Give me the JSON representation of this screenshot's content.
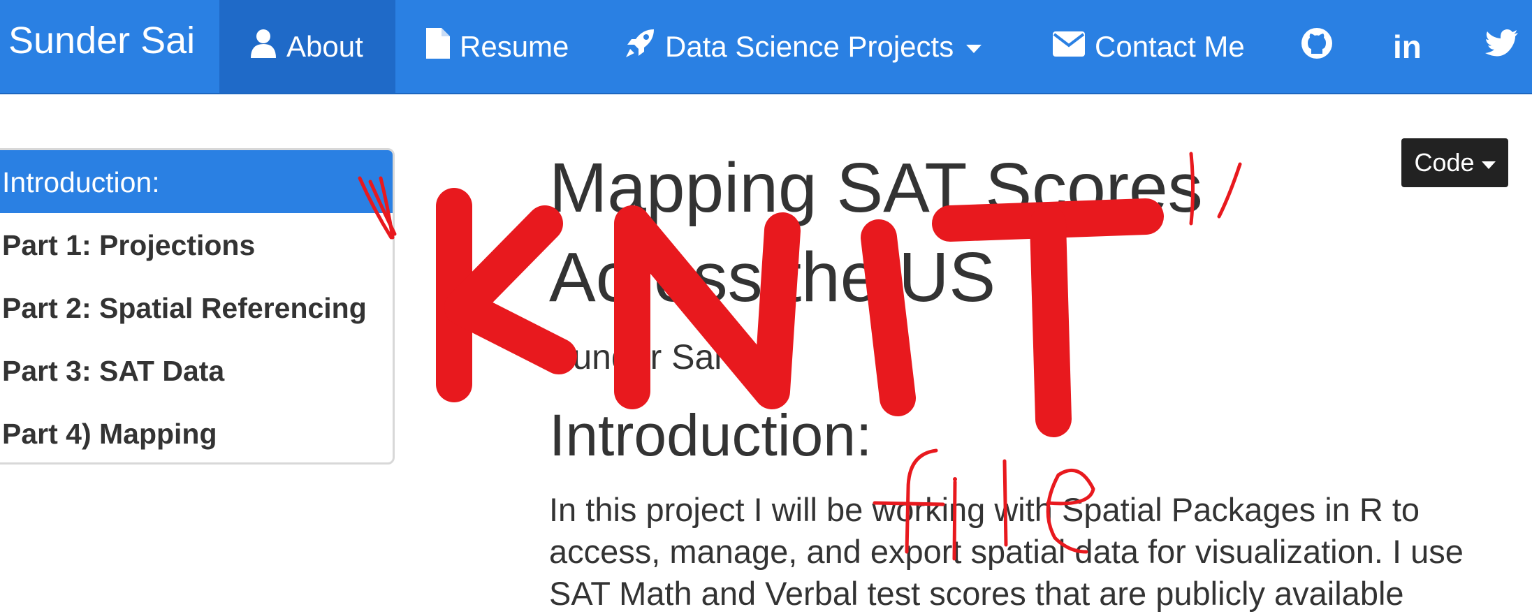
{
  "navbar": {
    "brand": "Sunder Sai",
    "items": [
      {
        "label": "About",
        "icon": "user-icon",
        "active": true
      },
      {
        "label": "Resume",
        "icon": "file-icon"
      },
      {
        "label": "Data Science Projects",
        "icon": "rocket-icon",
        "dropdown": true
      },
      {
        "label": "Contact Me",
        "icon": "envelope-icon"
      }
    ],
    "social": [
      "github-icon",
      "linkedin-icon",
      "twitter-icon"
    ],
    "linkedin_text": "in"
  },
  "toc": {
    "items": [
      {
        "label": "Introduction:",
        "active": true
      },
      {
        "label": "Part 1: Projections"
      },
      {
        "label": "Part 2: Spatial Referencing"
      },
      {
        "label": "Part 3: SAT Data"
      },
      {
        "label": "Part 4) Mapping"
      }
    ]
  },
  "code_button": {
    "label": "Code"
  },
  "main": {
    "title": "Mapping SAT Scores Across the US",
    "author": "Sunder Sai",
    "intro_heading": "Introduction:",
    "body": "In this project I will be working with Spatial Packages in R to access, manage, and export spatial data for visualization. I use SAT Math and Verbal test scores that are publicly available"
  },
  "annotation": {
    "scribble_text_1": "KNIT",
    "scribble_text_2": "file",
    "color": "#e8191e"
  },
  "colors": {
    "primary": "#2a80e3",
    "primary_active": "#1f6ac8",
    "text": "#333333",
    "code_btn": "#222222"
  }
}
